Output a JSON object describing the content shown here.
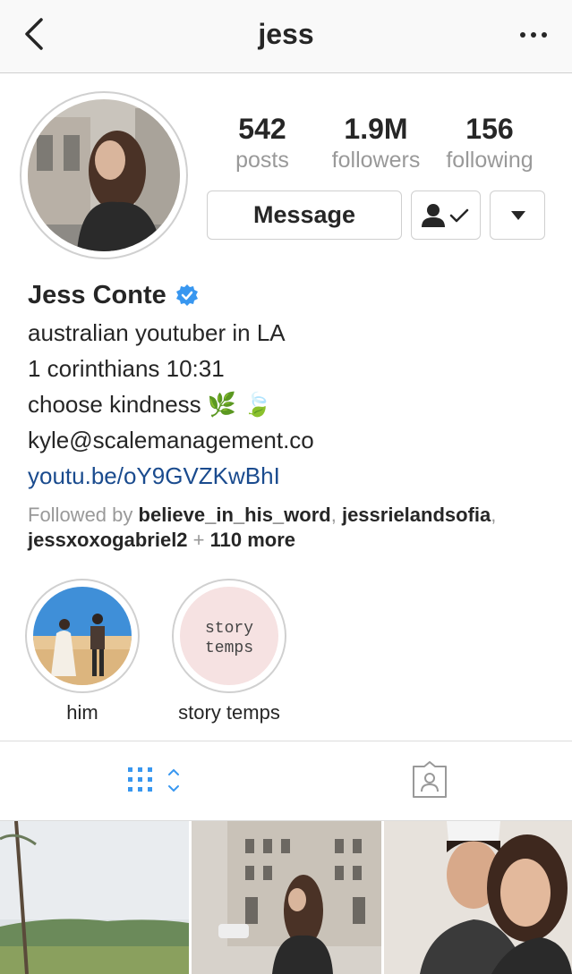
{
  "header": {
    "title": "jess"
  },
  "stats": [
    {
      "value": "542",
      "label": "posts"
    },
    {
      "value": "1.9M",
      "label": "followers"
    },
    {
      "value": "156",
      "label": "following"
    }
  ],
  "actions": {
    "message_label": "Message"
  },
  "profile": {
    "name": "Jess Conte",
    "bio_lines": [
      "australian youtuber in LA",
      "1 corinthians 10:31",
      "choose kindness 🌿 🍃",
      "kyle@scalemanagement.co"
    ],
    "link": "youtu.be/oY9GVZKwBhI"
  },
  "followed_by": {
    "prefix": "Followed by ",
    "user1": "believe_in_his_word",
    "sep": ", ",
    "user2": "jessrielandsofia",
    "sep2": ",",
    "user3": "jessxoxogabriel2",
    "plus": " + ",
    "more": "110 more"
  },
  "highlights": [
    {
      "label": "him"
    },
    {
      "label": "story temps",
      "cover_text": "story\ntemps"
    }
  ],
  "colors": {
    "accent": "#3897f0",
    "link": "#1a4b8e",
    "muted": "#999999",
    "border": "#cfcfcf"
  }
}
